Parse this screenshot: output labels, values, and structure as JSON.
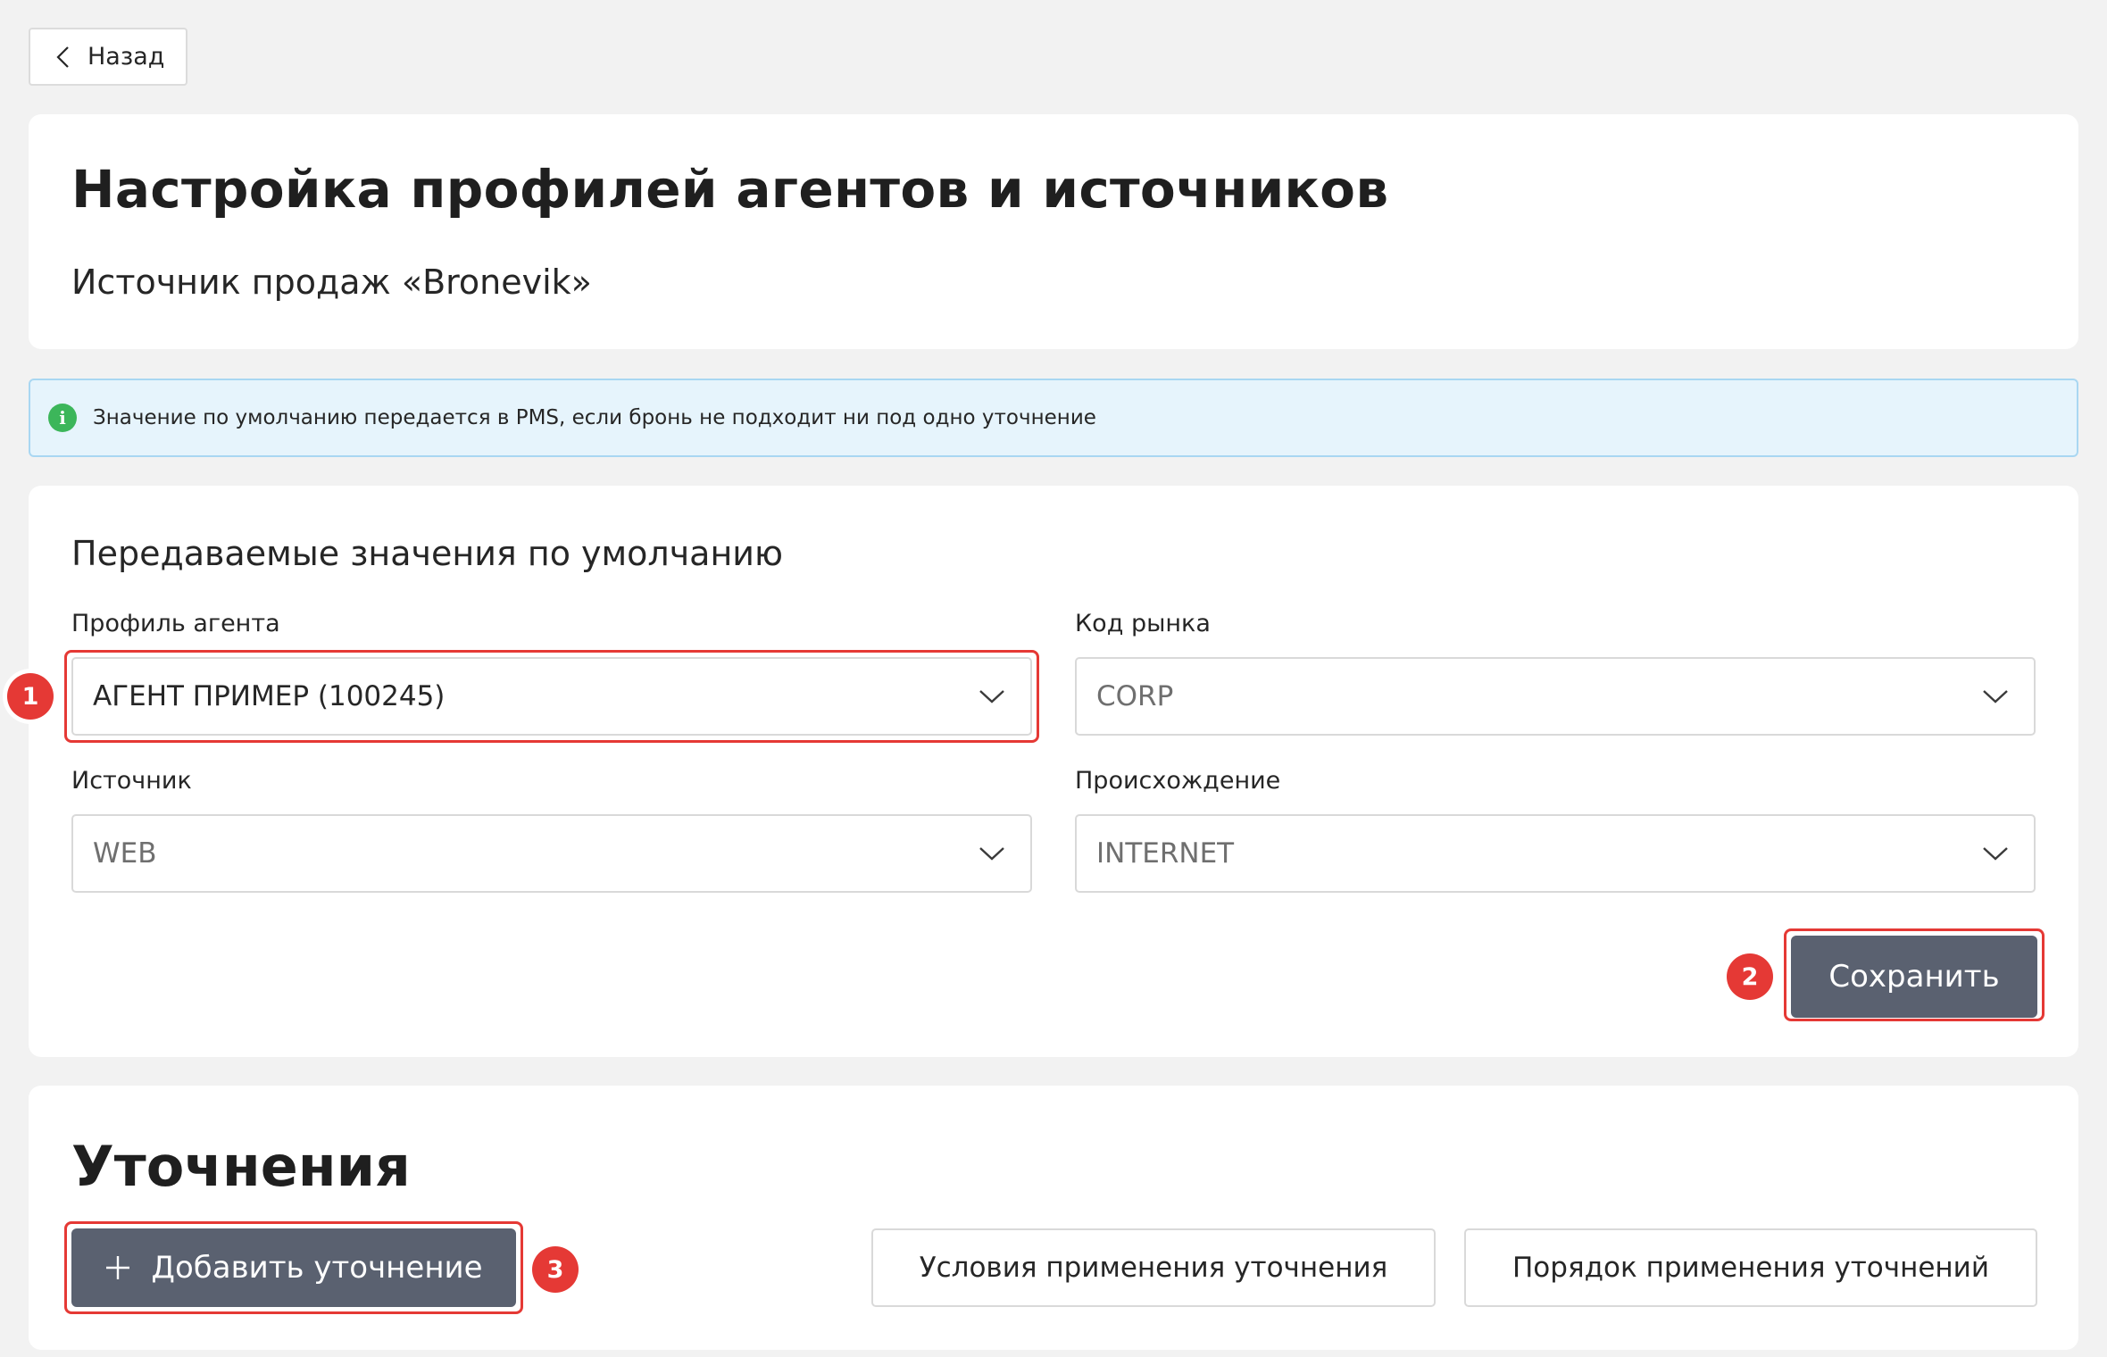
{
  "back_button": {
    "label": "Назад"
  },
  "header": {
    "title": "Настройка профилей агентов и источников",
    "subtitle": "Источник продаж «Bronevik»"
  },
  "info_banner": {
    "icon": "info-icon",
    "text": "Значение по умолчанию передается в PMS, если бронь не подходит ни под одно уточнение"
  },
  "defaults": {
    "title": "Передаваемые значения по умолчанию",
    "fields": {
      "agent_profile": {
        "label": "Профиль агента",
        "value": "АГЕНТ ПРИМЕР (100245)"
      },
      "market_code": {
        "label": "Код рынка",
        "value": "CORP"
      },
      "source": {
        "label": "Источник",
        "value": "WEB"
      },
      "origin": {
        "label": "Происхождение",
        "value": "INTERNET"
      }
    },
    "save_label": "Сохранить"
  },
  "refinements": {
    "title": "Уточнения",
    "add_label": "Добавить уточнение",
    "conditions_label": "Условия применения уточнения",
    "order_label": "Порядок применения уточнений"
  },
  "annotations": {
    "badge1": "1",
    "badge2": "2",
    "badge3": "3"
  },
  "colors": {
    "background": "#f2f2f2",
    "card": "#ffffff",
    "primary_button": "#5a6170",
    "info_bg": "#e6f4fc",
    "info_border": "#a9d7f2",
    "info_icon": "#3cb65a",
    "highlight": "#e53935"
  }
}
